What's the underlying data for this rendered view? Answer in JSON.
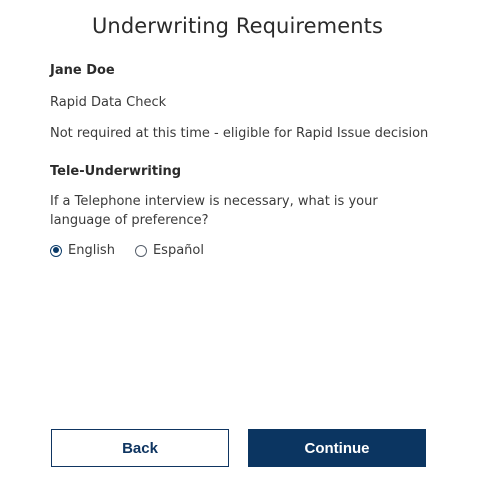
{
  "page": {
    "title": "Underwriting Requirements"
  },
  "applicant": {
    "name": "Jane Doe",
    "check_name": "Rapid Data Check",
    "check_status": "Not required at this time - eligible for Rapid Issue decision"
  },
  "tele_underwriting": {
    "heading": "Tele-Underwriting",
    "question": "If a Telephone interview is necessary, what is your language of preference?",
    "options": [
      {
        "label": "English",
        "selected": true
      },
      {
        "label": "Español",
        "selected": false
      }
    ],
    "selected_value": "English"
  },
  "actions": {
    "back_label": "Back",
    "continue_label": "Continue"
  },
  "colors": {
    "primary": "#0b3561",
    "text": "#2b2b2b",
    "background": "#ffffff"
  }
}
